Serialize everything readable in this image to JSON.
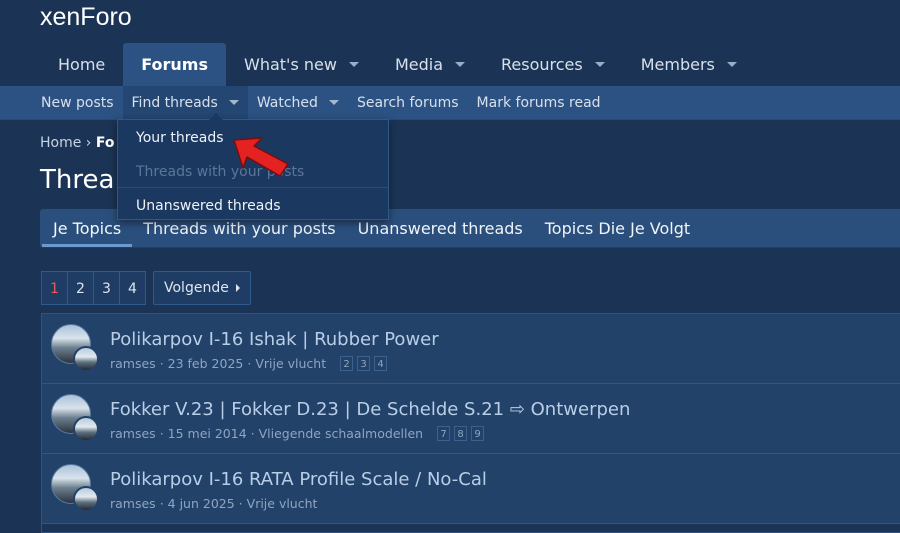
{
  "app": {
    "logo_text": "xenForo"
  },
  "nav": {
    "tabs": [
      {
        "label": "Home",
        "active": false,
        "has_caret": false
      },
      {
        "label": "Forums",
        "active": true,
        "has_caret": false
      },
      {
        "label": "What's new",
        "active": false,
        "has_caret": true
      },
      {
        "label": "Media",
        "active": false,
        "has_caret": true
      },
      {
        "label": "Resources",
        "active": false,
        "has_caret": true
      },
      {
        "label": "Members",
        "active": false,
        "has_caret": true
      }
    ]
  },
  "subnav": {
    "items": [
      {
        "label": "New posts"
      },
      {
        "label": "Find threads"
      },
      {
        "label": "Watched"
      },
      {
        "label": "Search forums"
      },
      {
        "label": "Mark forums read"
      }
    ]
  },
  "dropdown": {
    "items": [
      {
        "label": "Your threads",
        "disabled": false
      },
      {
        "label": "Threads with your posts",
        "disabled": true
      },
      {
        "label": "Unanswered threads",
        "disabled": false
      }
    ]
  },
  "breadcrumb": {
    "home": "Home",
    "current_partial": "Fo"
  },
  "page": {
    "title_partial": "Threa"
  },
  "tabs": [
    {
      "label": "Je Topics",
      "active": true
    },
    {
      "label": "Threads with your posts",
      "active": false
    },
    {
      "label": "Unanswered threads",
      "active": false
    },
    {
      "label": "Topics Die Je Volgt",
      "active": false
    }
  ],
  "pagination": {
    "pages": [
      "1",
      "2",
      "3",
      "4"
    ],
    "current": "1",
    "next_label": "Volgende"
  },
  "threads": [
    {
      "title": "Polikarpov I-16 Ishak | Rubber Power",
      "author": "ramses",
      "date": "23 feb 2025",
      "forum": "Vrije vlucht",
      "mini_pages": [
        "2",
        "3",
        "4"
      ]
    },
    {
      "title": "Fokker V.23 | Fokker D.23 | De Schelde S.21 ⇨ Ontwerpen",
      "author": "ramses",
      "date": "15 mei 2014",
      "forum": "Vliegende schaalmodellen",
      "mini_pages": [
        "7",
        "8",
        "9"
      ]
    },
    {
      "title": "Polikarpov I-16 RATA Profile Scale / No-Cal",
      "author": "ramses",
      "date": "4 jun 2025",
      "forum": "Vrije vlucht",
      "mini_pages": []
    }
  ],
  "colors": {
    "background": "#1b3455",
    "accent": "#2c5283",
    "current_page": "#e35b5b",
    "cursor_arrow": "#e52222"
  },
  "meta_separator": "·"
}
